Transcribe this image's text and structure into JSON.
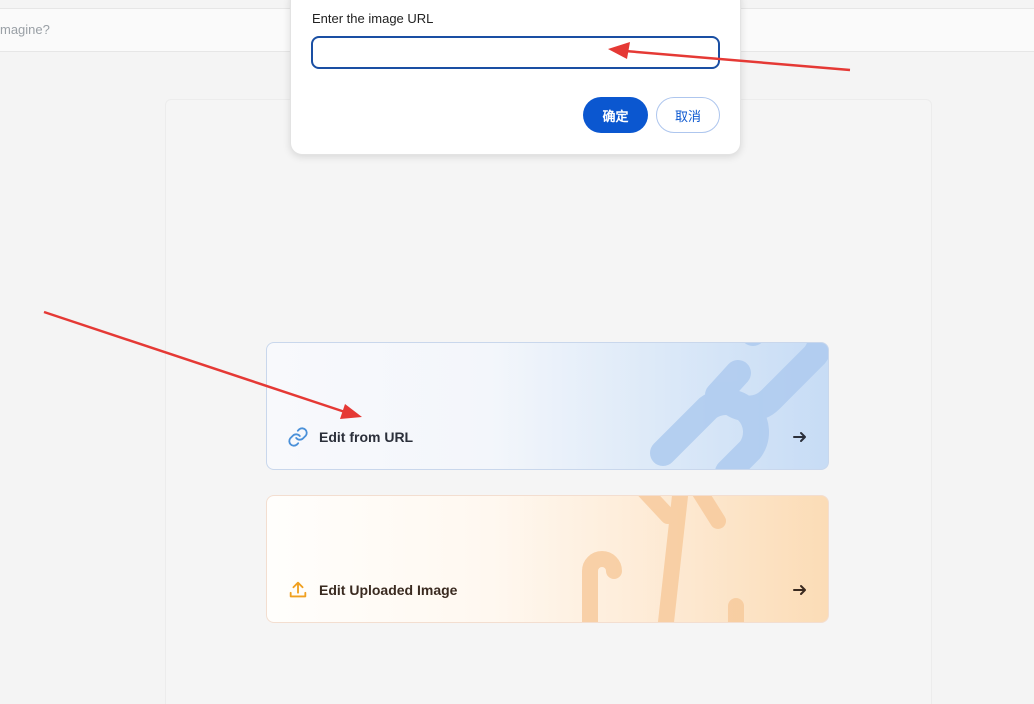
{
  "search_bar": {
    "placeholder": "magine?"
  },
  "dialog": {
    "label": "Enter the image URL",
    "input_value": "",
    "ok_label": "确定",
    "cancel_label": "取消"
  },
  "options": [
    {
      "label": "Edit from URL",
      "icon": "link-icon",
      "arrow": "arrow-right-icon"
    },
    {
      "label": "Edit Uploaded Image",
      "icon": "upload-icon",
      "arrow": "arrow-right-icon"
    }
  ],
  "colors": {
    "primary": "#0b57d0",
    "annotation": "#e53935",
    "link_icon": "#4a90d9",
    "upload_icon": "#f0a020"
  }
}
